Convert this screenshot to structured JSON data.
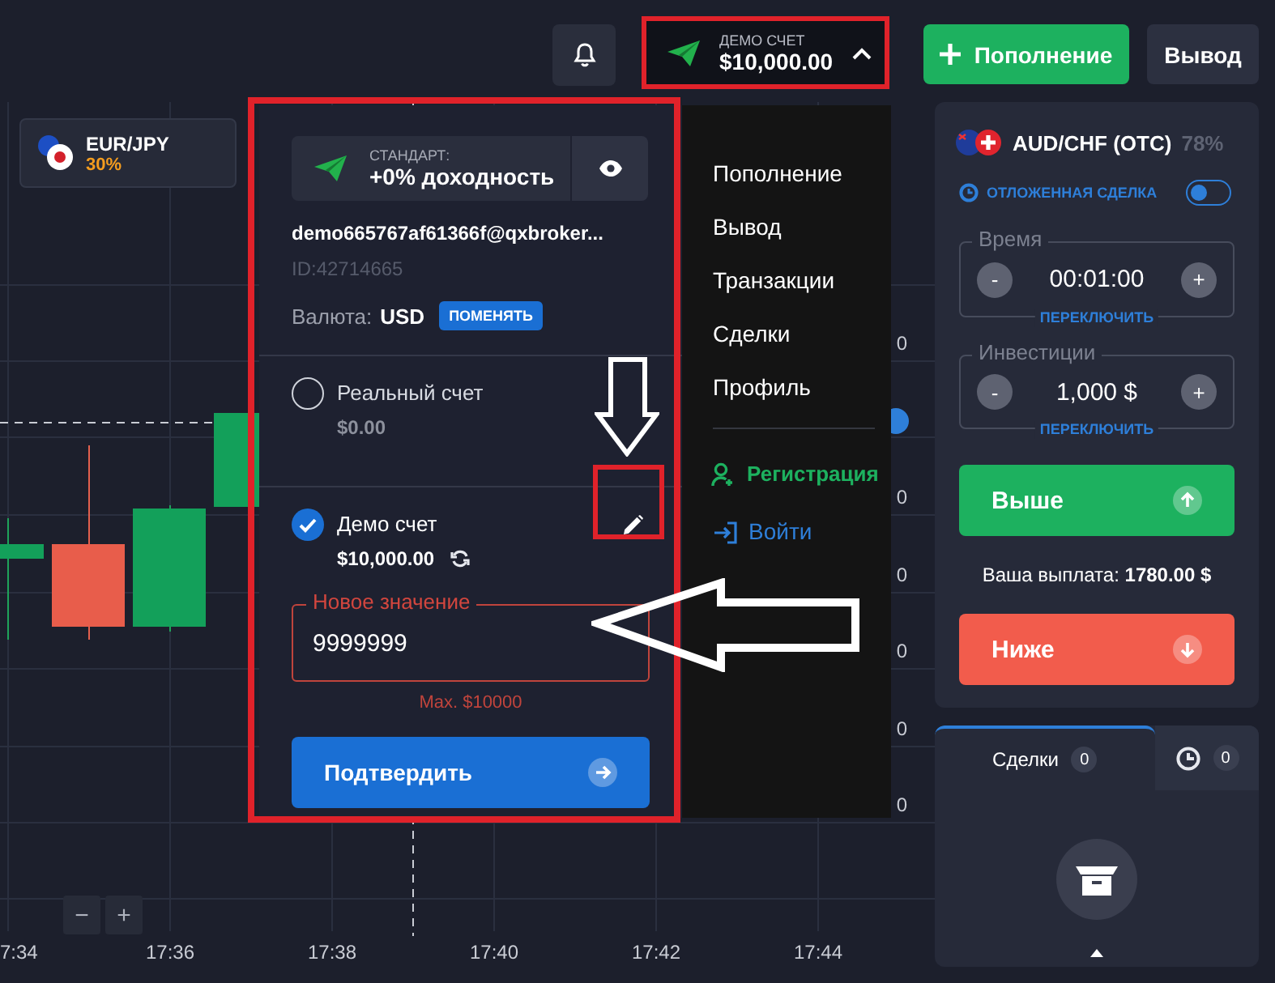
{
  "header": {
    "account_button": {
      "label": "ДЕМО СЧЕТ",
      "balance": "$10,000.00",
      "expanded": true
    },
    "deposit_button": "Пополнение",
    "withdraw_button": "Вывод"
  },
  "chart": {
    "asset": {
      "name": "EUR/JPY",
      "payout": "30%"
    },
    "time_labels": [
      "7:34",
      "17:36",
      "17:38",
      "17:40",
      "17:42",
      "17:44"
    ],
    "price_labels": [
      "0",
      "0",
      "0",
      "0",
      "0",
      "0"
    ],
    "zoom_buttons": [
      "−",
      "+"
    ]
  },
  "account_menu": {
    "tariff": {
      "label": "СТАНДАРТ:",
      "value": "+0% доходность"
    },
    "email": "demo665767af61366f@qxbroker...",
    "id": "ID:42714665",
    "currency": {
      "label": "Валюта:",
      "value": "USD",
      "action": "ПОМЕНЯТЬ"
    },
    "accounts": [
      {
        "name": "Реальный счет",
        "balance": "$0.00",
        "selected": false
      },
      {
        "name": "Демо счет",
        "balance": "$10,000.00",
        "selected": true
      }
    ],
    "new_value": {
      "label": "Новое значение",
      "value": "9999999",
      "hint": "Max. $10000"
    },
    "confirm_button": "Подтвердить",
    "nav_items": [
      {
        "label": "Пополнение",
        "kind": "plain"
      },
      {
        "label": "Вывод",
        "kind": "plain"
      },
      {
        "label": "Транзакции",
        "kind": "plain"
      },
      {
        "label": "Сделки",
        "kind": "plain"
      },
      {
        "label": "Профиль",
        "kind": "plain"
      },
      {
        "label": "Регистрация",
        "kind": "register"
      },
      {
        "label": "Войти",
        "kind": "login"
      }
    ]
  },
  "trade_panel": {
    "asset": "AUD/CHF (OTC)",
    "payout": "78%",
    "pending_trade": {
      "label": "ОТЛОЖЕННАЯ СДЕЛКА",
      "on": false
    },
    "steppers": [
      {
        "label": "Время",
        "value": "00:01:00",
        "minus": "-",
        "plus": "+",
        "switch": "ПЕРЕКЛЮЧИТЬ"
      },
      {
        "label": "Инвестиции",
        "value": "1,000 $",
        "minus": "-",
        "plus": "+",
        "switch": "ПЕРЕКЛЮЧИТЬ"
      }
    ],
    "up_button": "Выше",
    "payout_text": "Ваша выплата: **1780.00 $**",
    "down_button": "Ниже"
  },
  "trades_panel": {
    "tabs": [
      {
        "kind": "text",
        "label": "Сделки",
        "count": "0",
        "selected": true
      },
      {
        "kind": "clock",
        "count": "0",
        "selected": false
      }
    ]
  }
}
